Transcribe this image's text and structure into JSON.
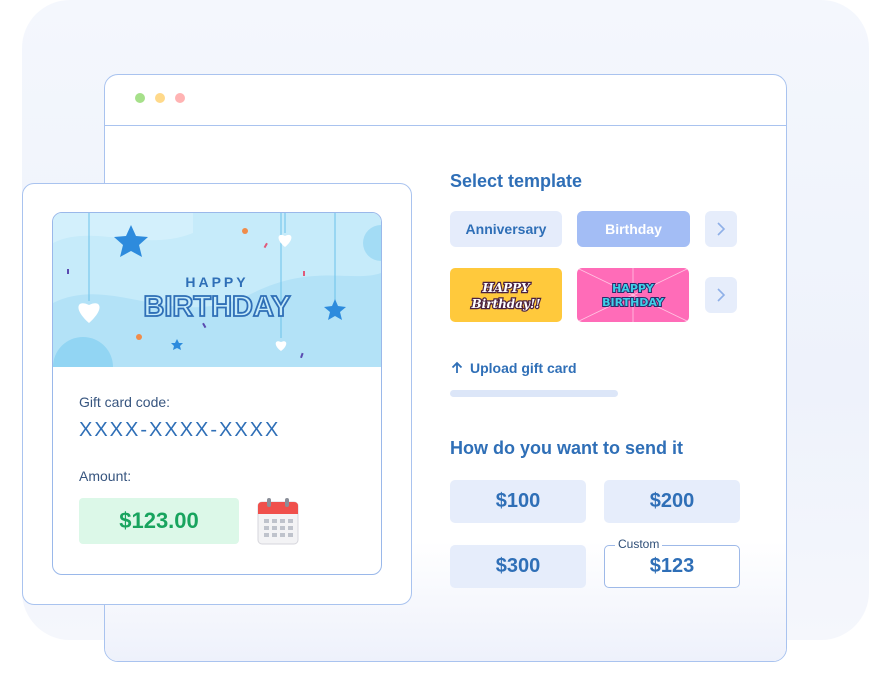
{
  "template_section": {
    "title": "Select template",
    "buttons": [
      "Anniversary",
      "Birthday"
    ],
    "active": "Birthday",
    "thumbnails": [
      {
        "text_line1": "HAPPY",
        "text_line2": "Birthday!!",
        "bg": "#ffc93c"
      },
      {
        "text_line1": "HAPPY",
        "text_line2": "BIRTHDAY",
        "bg": "#ff6cb8"
      }
    ]
  },
  "upload": {
    "label": "Upload gift card",
    "icon": "arrow-up-icon"
  },
  "send_section": {
    "title": "How do you want to send it",
    "amounts": [
      "$100",
      "$200",
      "$300"
    ],
    "custom_label": "Custom",
    "custom_value": "$123"
  },
  "card": {
    "banner_line1": "HAPPY",
    "banner_line2": "BIRTHDAY",
    "code_label": "Gift card code:",
    "code_value": "XXXX-XXXX-XXXX",
    "amount_label": "Amount:",
    "amount_value": "$123.00",
    "calendar_icon": "calendar-icon"
  },
  "colors": {
    "accent": "#2f6fb7",
    "border": "#a9c3ef",
    "green": "#18a45e"
  }
}
